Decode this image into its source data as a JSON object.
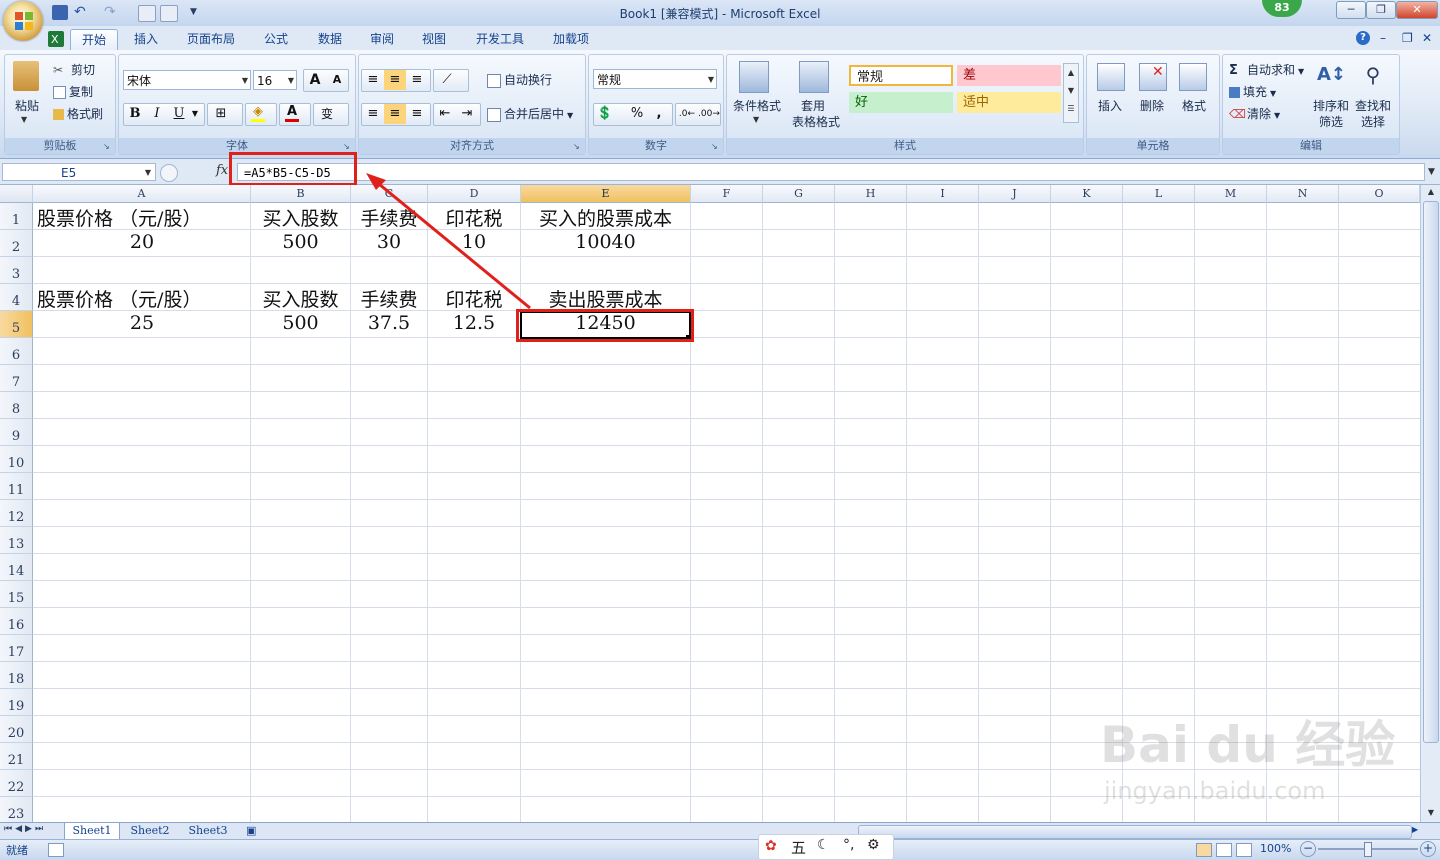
{
  "window": {
    "title": "Book1  [兼容模式] - Microsoft Excel",
    "badge": "83",
    "minimize": "─",
    "restore": "❐",
    "close": "✕"
  },
  "tabs": [
    "开始",
    "插入",
    "页面布局",
    "公式",
    "数据",
    "审阅",
    "视图",
    "开发工具",
    "加载项"
  ],
  "tab_help": "?",
  "ribbon": {
    "clipboard": {
      "label": "剪贴板",
      "paste": "粘贴",
      "cut": "剪切",
      "copy": "复制",
      "format_painter": "格式刷"
    },
    "font": {
      "label": "字体",
      "font_name": "宋体",
      "font_size": "16",
      "grow": "A",
      "shrink": "A",
      "bold": "B",
      "italic": "I",
      "underline": "U",
      "wen": "变"
    },
    "alignment": {
      "label": "对齐方式",
      "wrap": "自动换行",
      "merge": "合并后居中"
    },
    "number": {
      "label": "数字",
      "format": "常规",
      "percent": "%",
      "comma": ","
    },
    "styles": {
      "label": "样式",
      "conditional": "条件格式",
      "table_format_1": "套用",
      "table_format_2": "表格格式",
      "normal": "常规",
      "bad": "差",
      "good": "好",
      "neutral": "适中"
    },
    "cells": {
      "label": "单元格",
      "insert": "插入",
      "delete": "删除",
      "format": "格式"
    },
    "editing": {
      "label": "编辑",
      "autosum": "自动求和",
      "fill": "填充",
      "clear": "清除",
      "sort_1": "排序和",
      "sort_2": "筛选",
      "find_1": "查找和",
      "find_2": "选择"
    }
  },
  "formula_bar": {
    "name_box": "E5",
    "fx": "fx",
    "formula": "=A5*B5-C5-D5"
  },
  "columns": [
    "A",
    "B",
    "C",
    "D",
    "E",
    "F",
    "G",
    "H",
    "I",
    "J",
    "K",
    "L",
    "M",
    "N",
    "O"
  ],
  "rows": [
    "1",
    "2",
    "3",
    "4",
    "5",
    "6",
    "7",
    "8",
    "9",
    "10",
    "11",
    "12",
    "13",
    "14",
    "15",
    "16",
    "17",
    "18",
    "19",
    "20",
    "21",
    "22",
    "23"
  ],
  "cells": {
    "A1": "股票价格 （元/股）",
    "B1": "买入股数",
    "C1": "手续费",
    "D1": "印花税",
    "E1": "买入的股票成本",
    "A2": "20",
    "B2": "500",
    "C2": "30",
    "D2": "10",
    "E2": "10040",
    "A4": "股票价格 （元/股）",
    "B4": "买入股数",
    "C4": "手续费",
    "D4": "印花税",
    "E4": "卖出股票成本",
    "A5": "25",
    "B5": "500",
    "C5": "37.5",
    "D5": "12.5",
    "E5": "12450"
  },
  "sheets": [
    "Sheet1",
    "Sheet2",
    "Sheet3"
  ],
  "status": {
    "ready": "就绪",
    "zoom": "100%"
  },
  "ime": [
    "五"
  ],
  "watermark": {
    "brand": "Bai du 经验",
    "url": "jingyan.baidu.com"
  },
  "annotation_color": "#e0201b"
}
